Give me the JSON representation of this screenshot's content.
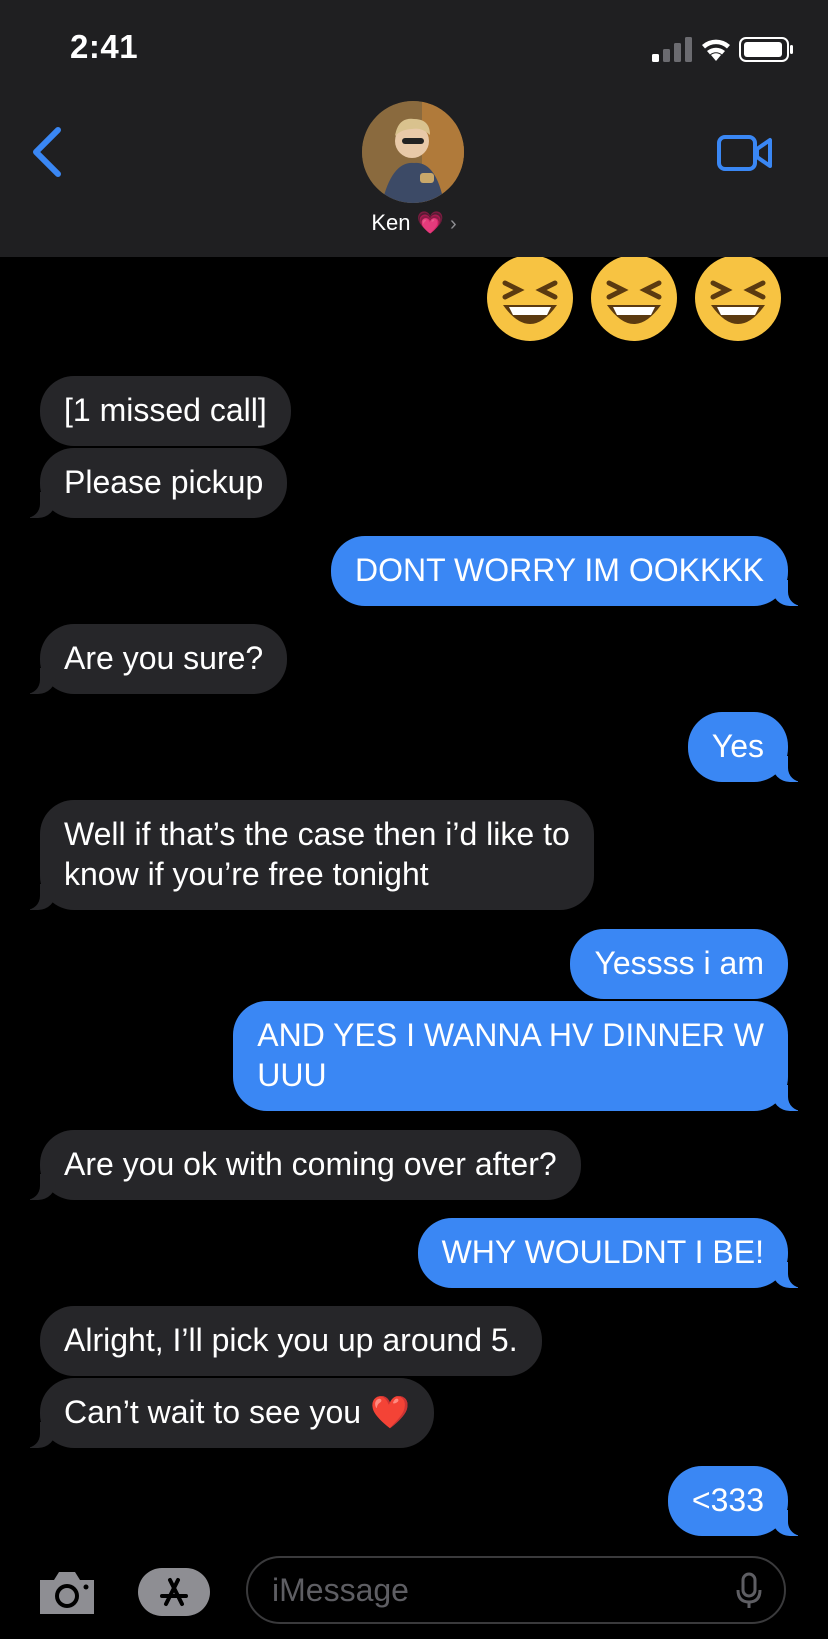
{
  "status_bar": {
    "time": "2:41"
  },
  "header": {
    "contact_name": "Ken 💗",
    "chevron": "›",
    "back_icon": "chevron-left-icon",
    "video_icon": "video-camera-icon"
  },
  "emojis": [
    "😆",
    "😆",
    "😆"
  ],
  "messages": [
    {
      "side": "in",
      "text": "[1 missed call]"
    },
    {
      "side": "in",
      "text": "Please pickup"
    },
    {
      "side": "out",
      "text": "DONT WORRY IM OOKKKK"
    },
    {
      "side": "in",
      "text": "Are you sure?"
    },
    {
      "side": "out",
      "text": "Yes"
    },
    {
      "side": "in",
      "text": "Well if that’s the case then i’d like to\nknow if you’re free tonight"
    },
    {
      "side": "out",
      "text": "Yessss i am"
    },
    {
      "side": "out",
      "text": "AND YES I WANNA HV DINNER W\nUUU"
    },
    {
      "side": "in",
      "text": "Are you ok with coming over after?"
    },
    {
      "side": "out",
      "text": "WHY WOULDNT I BE!"
    },
    {
      "side": "in",
      "text": "Alright, I’ll pick you up around 5."
    },
    {
      "side": "in",
      "text": "Can’t wait to see you ❤️"
    },
    {
      "side": "out",
      "text": "<333"
    }
  ],
  "composer": {
    "placeholder": "iMessage",
    "camera_icon": "camera-icon",
    "apps_icon": "app-store-icon",
    "mic_icon": "microphone-icon"
  },
  "colors": {
    "outgoing": "#3a87f4",
    "incoming": "#262629",
    "accent": "#3a87f4"
  }
}
